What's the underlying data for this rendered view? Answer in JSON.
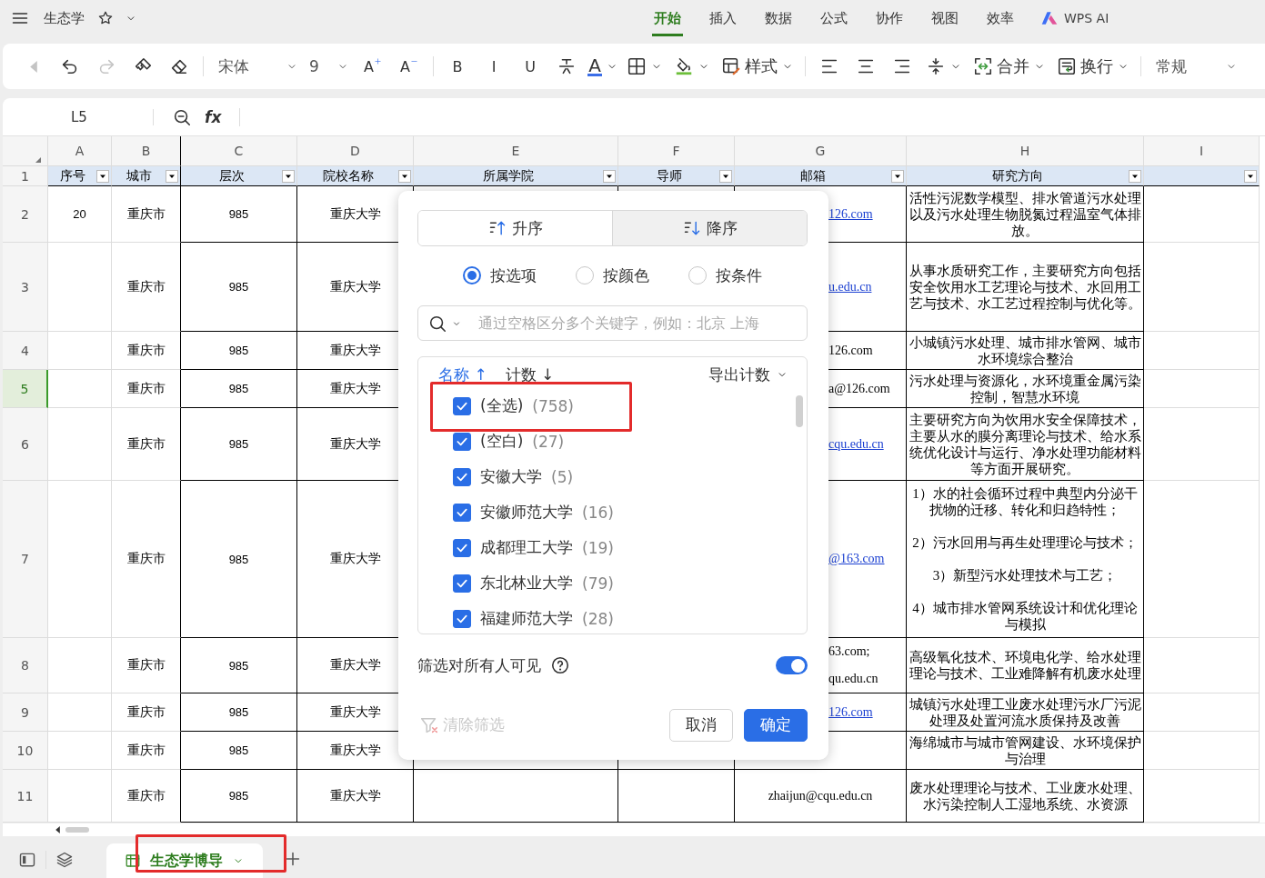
{
  "app_bar": {
    "title": "生态学",
    "favorite": false,
    "tabs": [
      {
        "label": "开始",
        "selected": true
      },
      {
        "label": "插入",
        "selected": false
      },
      {
        "label": "数据",
        "selected": false
      },
      {
        "label": "公式",
        "selected": false
      },
      {
        "label": "协作",
        "selected": false
      },
      {
        "label": "视图",
        "selected": false
      },
      {
        "label": "效率",
        "selected": false
      }
    ],
    "ai_label": "WPS AI"
  },
  "toolbar": {
    "items": [
      {
        "kind": "back",
        "disabled": true
      },
      {
        "kind": "undo",
        "disabled": false
      },
      {
        "kind": "redo",
        "disabled": true
      },
      {
        "kind": "painter",
        "disabled": false
      },
      {
        "kind": "eraser",
        "disabled": false
      },
      {
        "kind": "sep"
      },
      {
        "kind": "font",
        "label": "宋体",
        "disabled": false
      },
      {
        "kind": "size",
        "label": "9",
        "disabled": false
      },
      {
        "kind": "grow",
        "label": "A",
        "disabled": false
      },
      {
        "kind": "shrink",
        "label": "A",
        "disabled": false
      },
      {
        "kind": "sep"
      },
      {
        "kind": "bold",
        "label": "B",
        "disabled": false
      },
      {
        "kind": "italic",
        "label": "I",
        "disabled": false
      },
      {
        "kind": "underline",
        "label": "U",
        "disabled": false
      },
      {
        "kind": "strike",
        "disabled": false
      },
      {
        "kind": "font_color",
        "label": "A",
        "disabled": false
      },
      {
        "kind": "borders",
        "disabled": false
      },
      {
        "kind": "fill",
        "disabled": false
      },
      {
        "kind": "style",
        "label": "样式",
        "disabled": false
      },
      {
        "kind": "sep"
      },
      {
        "kind": "align_left",
        "disabled": false
      },
      {
        "kind": "align_center",
        "disabled": false
      },
      {
        "kind": "align_right",
        "disabled": false
      },
      {
        "kind": "valign",
        "disabled": false
      },
      {
        "kind": "merge",
        "label": "合并",
        "disabled": false
      },
      {
        "kind": "wrap",
        "label": "换行",
        "disabled": false
      },
      {
        "kind": "sep"
      },
      {
        "kind": "format",
        "label": "常规",
        "disabled": false
      }
    ]
  },
  "formula_bar": {
    "cell_ref": "L5",
    "fx_label": "fx"
  },
  "sheet": {
    "columns": [
      "A",
      "B",
      "C",
      "D",
      "E",
      "F",
      "G",
      "H",
      "I"
    ],
    "header_row": {
      "number": "1",
      "labels": [
        "序号",
        "城市",
        "层次",
        "院校名称",
        "所属学院",
        "导师",
        "邮箱",
        "研究方向"
      ]
    },
    "rows": [
      {
        "number": "2",
        "selected": false,
        "cells": [
          "20",
          "重庆市",
          "985",
          "重庆大学",
          null,
          null,
          {
            "lines": [
              "126.com"
            ],
            "link": true
          },
          "活性污泥数学模型、排水管道污水处理以及污水处理生物脱氮过程温室气体排放。"
        ]
      },
      {
        "number": "3",
        "selected": false,
        "cells": [
          null,
          "重庆市",
          "985",
          "重庆大学",
          null,
          null,
          {
            "lines": [
              "u.edu.cn"
            ],
            "link": true
          },
          "从事水质研究工作，主要研究方向包括安全饮用水工艺理论与技术、水回用工艺与技术、水工艺过程控制与优化等。"
        ]
      },
      {
        "number": "4",
        "selected": false,
        "cells": [
          null,
          "重庆市",
          "985",
          "重庆大学",
          null,
          null,
          {
            "lines": [
              "126.com"
            ],
            "link": false
          },
          "小城镇污水处理、城市排水管网、城市水环境综合整治"
        ]
      },
      {
        "number": "5",
        "selected": true,
        "cells": [
          null,
          "重庆市",
          "985",
          "重庆大学",
          null,
          null,
          {
            "lines": [
              "a@126.com"
            ],
            "link": false
          },
          "污水处理与资源化，水环境重金属污染控制，智慧水环境"
        ]
      },
      {
        "number": "6",
        "selected": false,
        "cells": [
          null,
          "重庆市",
          "985",
          "重庆大学",
          null,
          null,
          {
            "lines": [
              "cqu.edu.cn"
            ],
            "link": true
          },
          "主要研究方向为饮用水安全保障技术，主要从水的膜分离理论与技术、给水系统优化设计与运行、净水处理功能材料等方面开展研究。"
        ]
      },
      {
        "number": "7",
        "selected": false,
        "cells": [
          null,
          "重庆市",
          "985",
          "重庆大学",
          null,
          null,
          {
            "lines": [
              "@163.com"
            ],
            "link": true
          },
          "1）水的社会循环过程中典型内分泌干扰物的迁移、转化和归趋特性；\n\n2）污水回用与再生处理理论与技术；\n\n3）新型污水处理技术与工艺；\n\n4）城市排水管网系统设计和优化理论与模拟"
        ]
      },
      {
        "number": "8",
        "selected": false,
        "cells": [
          null,
          "重庆市",
          "985",
          "重庆大学",
          null,
          null,
          {
            "lines": [
              "63.com;",
              "qu.edu.cn"
            ],
            "link": false
          },
          "高级氧化技术、环境电化学、给水处理理论与技术、工业难降解有机废水处理"
        ]
      },
      {
        "number": "9",
        "selected": false,
        "cells": [
          null,
          "重庆市",
          "985",
          "重庆大学",
          null,
          null,
          {
            "lines": [
              "126.com"
            ],
            "link": true
          },
          "城镇污水处理工业废水处理污水厂污泥处理及处置河流水质保持及改善"
        ]
      },
      {
        "number": "10",
        "selected": false,
        "cells": [
          null,
          "重庆市",
          "985",
          "重庆大学",
          null,
          null,
          null,
          "海绵城市与城市管网建设、水环境保护与治理"
        ]
      },
      {
        "number": "11",
        "selected": false,
        "cells": [
          null,
          "重庆市",
          "985",
          "重庆大学",
          null,
          null,
          {
            "lines": [
              "zhaijun@cqu.edu.cn"
            ],
            "link": false
          },
          "废水处理理论与技术、工业废水处理、水污染控制人工湿地系统、水资源"
        ]
      }
    ],
    "tabs": [
      {
        "label": "生态学博导",
        "selected": true,
        "annotated": true
      }
    ]
  },
  "filter_popup": {
    "sort_buttons": [
      {
        "label": "升序",
        "kind": "ascending",
        "selected": false
      },
      {
        "label": "降序",
        "kind": "descending",
        "selected": true
      }
    ],
    "modes": [
      {
        "label": "按选项",
        "selected": true
      },
      {
        "label": "按颜色",
        "selected": false
      },
      {
        "label": "按条件",
        "selected": false
      }
    ],
    "search": {
      "placeholder": "通过空格区分多个关键字，例如：北京 上海"
    },
    "sort_links": [
      {
        "label": "名称 ↑",
        "active": true
      },
      {
        "label": "计数 ↓",
        "active": false
      }
    ],
    "export": "导出计数",
    "items": [
      {
        "label": "(全选)",
        "count": "(758)",
        "checked": true,
        "annotated": true
      },
      {
        "label": "(空白)",
        "count": "(27)",
        "checked": true,
        "annotated": false
      },
      {
        "label": "安徽大学",
        "count": "(5)",
        "checked": true,
        "annotated": false
      },
      {
        "label": "安徽师范大学",
        "count": "(16)",
        "checked": true,
        "annotated": false
      },
      {
        "label": "成都理工大学",
        "count": "(19)",
        "checked": true,
        "annotated": false
      },
      {
        "label": "东北林业大学",
        "count": "(79)",
        "checked": true,
        "annotated": false
      },
      {
        "label": "福建师范大学",
        "count": "(28)",
        "checked": true,
        "annotated": false
      }
    ],
    "visible_to_all": {
      "label": "筛选对所有人可见",
      "on": true
    },
    "clear": {
      "label": "清除筛选",
      "disabled": true
    },
    "buttons": [
      {
        "label": "取消",
        "kind": "secondary"
      },
      {
        "label": "确定",
        "kind": "primary"
      }
    ]
  }
}
